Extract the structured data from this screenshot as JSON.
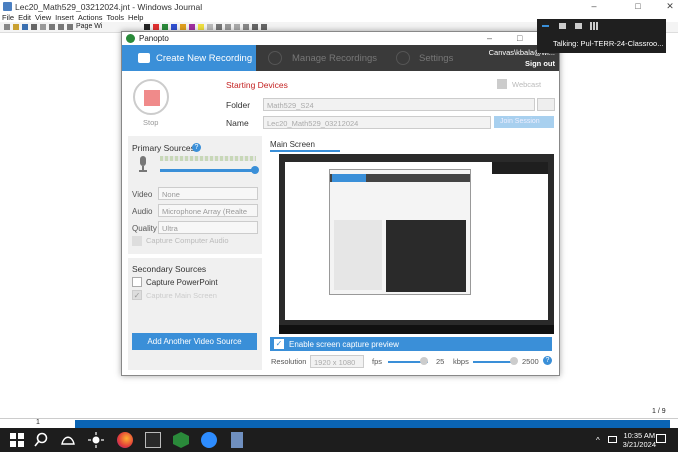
{
  "journal": {
    "title": "Lec20_Math529_03212024.jnt - Windows Journal",
    "menu": [
      "File",
      "Edit",
      "View",
      "Insert",
      "Actions",
      "Tools",
      "Help"
    ],
    "toolbar_pagewidth": "Page Wi",
    "page_number": "1",
    "page_count": "1 / 9"
  },
  "notification": {
    "talking": "Talking:  Pul-TERR-24-Classroo..."
  },
  "panopto": {
    "title": "Panopto",
    "tabs": {
      "create": "Create New Recording",
      "manage": "Manage Recordings",
      "settings": "Settings"
    },
    "user": "Canvas\\kbala@wi...",
    "sign_out": "Sign out",
    "stop_label": "Stop",
    "starting_devices": "Starting Devices",
    "webcast": "Webcast",
    "folder_label": "Folder",
    "folder_value": "Math529_S24",
    "name_label": "Name",
    "name_value": "Lec20_Math529_03212024",
    "join_session": "Join Session",
    "primary_sources": "Primary Sources",
    "video_label": "Video",
    "video_value": "None",
    "audio_label": "Audio",
    "audio_value": "Microphone Array (Realte",
    "quality_label": "Quality",
    "quality_value": "Ultra",
    "capture_computer_audio": "Capture Computer Audio",
    "secondary_sources": "Secondary Sources",
    "capture_powerpoint": "Capture PowerPoint",
    "capture_main_screen": "Capture Main Screen",
    "add_video_source": "Add Another Video Source",
    "main_screen_tab": "Main Screen",
    "enable_preview": "Enable screen capture preview",
    "resolution_label": "Resolution",
    "resolution_value": "1920 x 1080",
    "fps_label": "fps",
    "fps_value": "25",
    "kbps_label": "kbps",
    "kbps_value": "2500"
  },
  "taskbar": {
    "time": "10:35 AM",
    "date": "3/21/2024"
  },
  "colors": {
    "accent": "#3a8fd8",
    "starting": "#c42323",
    "taskbar": "#1d1d1d",
    "status_bar": "#0a64b4"
  }
}
